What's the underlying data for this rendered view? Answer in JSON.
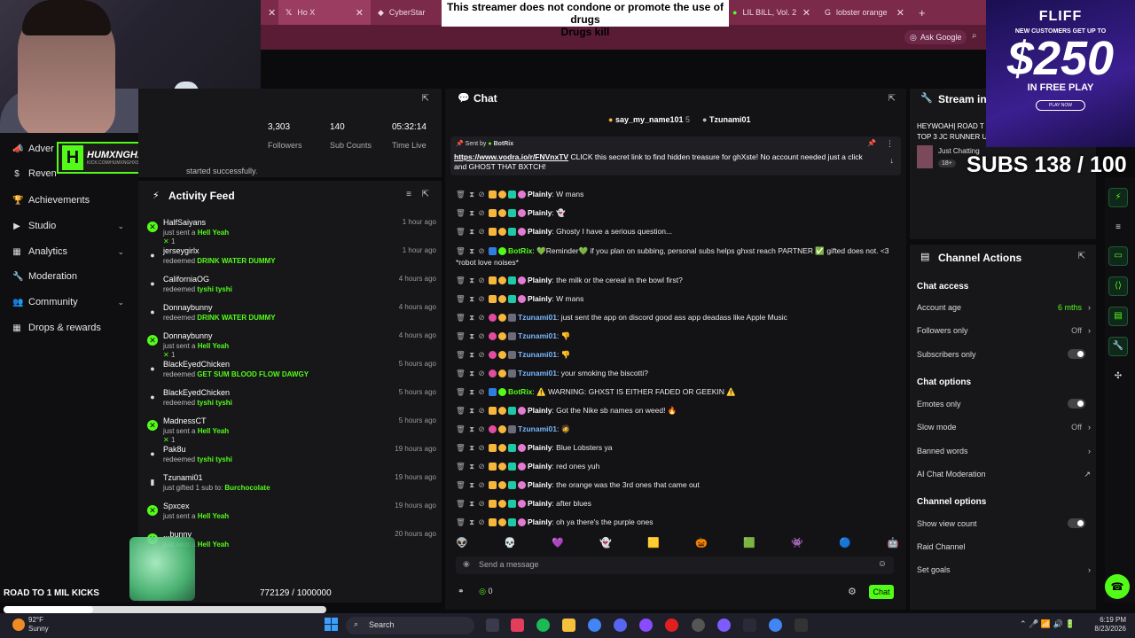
{
  "browser": {
    "tabs": [
      {
        "label": "Ho X",
        "active": true
      },
      {
        "label": "CyberStar",
        "active": false
      },
      {
        "label": "LIL BILL, Vol. 2",
        "active": false
      },
      {
        "label": "lobster orange",
        "active": false
      }
    ],
    "ask_google": "Ask Google",
    "banner_line1": "This streamer does not condone or promote the use of drugs",
    "banner_line2": "Drugs kill"
  },
  "overlay": {
    "logo_name": "HUMXNGHXST",
    "logo_sub": "KICK.COM/HUMXNGHXST",
    "subs": "SUBS 138 / 100",
    "road_label": "ROAD TO 1 MIL KICKS",
    "road_count": "772129 / 1000000",
    "road_progress": 0.772,
    "fliff": {
      "brand": "FLIFF",
      "new_customers": "NEW CUSTOMERS GET UP TO",
      "amount": "$250",
      "free_play": "IN FREE PLAY",
      "play_now": "PLAY NOW"
    }
  },
  "sidebar": {
    "items": [
      {
        "label": "Adver",
        "icon": "megaphone-icon",
        "chevron": false
      },
      {
        "label": "Reven",
        "icon": "dollar-icon",
        "chevron": false
      },
      {
        "label": "Achievements",
        "icon": "medal-icon",
        "chevron": false
      },
      {
        "label": "Studio",
        "icon": "studio-icon",
        "chevron": true
      },
      {
        "label": "Analytics",
        "icon": "chart-icon",
        "chevron": true
      },
      {
        "label": "Moderation",
        "icon": "wrench-icon",
        "chevron": false
      },
      {
        "label": "Community",
        "icon": "people-icon",
        "chevron": true
      },
      {
        "label": "Drops & rewards",
        "icon": "grid-icon",
        "chevron": false
      }
    ]
  },
  "stats": {
    "followers_value": "3,303",
    "followers_label": "Followers",
    "subs_value": "140",
    "subs_label": "Sub Counts",
    "time_value": "05:32:14",
    "time_label": "Time Live",
    "status": "started successfully."
  },
  "activity": {
    "title": "Activity Feed",
    "items": [
      {
        "name": "HalfSaiyans",
        "action": "just sent a",
        "item": "Hell Yeah",
        "count": "1",
        "time": "1 hour ago",
        "type": "kick"
      },
      {
        "name": "jerseygirlx",
        "action": "redeemed",
        "item": "DRINK WATER DUMMY",
        "count": "",
        "time": "1 hour ago",
        "type": "redeem"
      },
      {
        "name": "CaliforniaOG",
        "action": "redeemed",
        "item": "tyshi tyshi",
        "count": "",
        "time": "4 hours ago",
        "type": "redeem"
      },
      {
        "name": "Donnaybunny",
        "action": "redeemed",
        "item": "DRINK WATER DUMMY",
        "count": "",
        "time": "4 hours ago",
        "type": "redeem"
      },
      {
        "name": "Donnaybunny",
        "action": "just sent a",
        "item": "Hell Yeah",
        "count": "1",
        "time": "4 hours ago",
        "type": "kick"
      },
      {
        "name": "BlackEyedChicken",
        "action": "redeemed",
        "item": "GET SUM BLOOD FLOW DAWGY",
        "count": "",
        "time": "5 hours ago",
        "type": "redeem"
      },
      {
        "name": "BlackEyedChicken",
        "action": "redeemed",
        "item": "tyshi tyshi",
        "count": "",
        "time": "5 hours ago",
        "type": "redeem"
      },
      {
        "name": "MadnessCT",
        "action": "just sent a",
        "item": "Hell Yeah",
        "count": "1",
        "time": "5 hours ago",
        "type": "kick"
      },
      {
        "name": "Pak8u",
        "action": "redeemed",
        "item": "tyshi tyshi",
        "count": "",
        "time": "19 hours ago",
        "type": "redeem"
      },
      {
        "name": "Tzunami01",
        "action": "just gifted 1 sub to:",
        "item": "Burchocolate",
        "count": "",
        "time": "19 hours ago",
        "type": "gift"
      },
      {
        "name": "Spxcex",
        "action": "just sent a",
        "item": "Hell Yeah",
        "count": "",
        "time": "19 hours ago",
        "type": "kick"
      },
      {
        "name": "...bunny",
        "action": "just sent a",
        "item": "Hell Yeah",
        "count": "",
        "time": "20 hours ago",
        "type": "kick"
      }
    ]
  },
  "chat": {
    "title": "Chat",
    "top_chatters": [
      {
        "name": "say_my_name101",
        "count": "5"
      },
      {
        "name": "Tzunami01",
        "count": ""
      }
    ],
    "pinned_by_label": "Sent by",
    "pinned_by": "BotRix",
    "pinned_link": "https://www.vodra.io/r/FNVnxTV",
    "pinned_text": " CLICK this secret link to find hidden treasure for ghXste! No account needed just a click and GHOST THAT BXTCH!",
    "messages": [
      {
        "user": "Plainly",
        "text": " W mans",
        "color": "#ffffff"
      },
      {
        "user": "Plainly",
        "text": " 👻",
        "color": "#ffffff"
      },
      {
        "user": "Plainly",
        "text": " Ghosty I have a serious question...",
        "color": "#ffffff"
      },
      {
        "user": "BotRix",
        "text": " 💚Reminder💚 if you plan on subbing, personal subs helps ghxst reach PARTNER ✅ gifted does not. <3 *robot love noises*",
        "color": "#53fc18"
      },
      {
        "user": "Plainly",
        "text": " the milk or the cereal in the bowl first?",
        "color": "#ffffff"
      },
      {
        "user": "Plainly",
        "text": " W mans",
        "color": "#ffffff"
      },
      {
        "user": "Tzunami01",
        "text": " just sent the app on discord good ass app deadass like Apple Music",
        "color": "#7ab8ff"
      },
      {
        "user": "Tzunami01",
        "text": " 👎",
        "color": "#7ab8ff"
      },
      {
        "user": "Tzunami01",
        "text": " 👎",
        "color": "#7ab8ff"
      },
      {
        "user": "Tzunami01",
        "text": " your smoking the biscotti?",
        "color": "#7ab8ff"
      },
      {
        "user": "BotRix",
        "text": " ⚠️ WARNING: GHXST IS EITHER FADED OR GEEKIN ⚠️",
        "color": "#53fc18"
      },
      {
        "user": "Plainly",
        "text": " Got the Nike sb names on weed! 🔥",
        "color": "#ffffff"
      },
      {
        "user": "Tzunami01",
        "text": " 🧔",
        "color": "#7ab8ff"
      },
      {
        "user": "Plainly",
        "text": " Blue Lobsters ya",
        "color": "#ffffff"
      },
      {
        "user": "Plainly",
        "text": " red ones yuh",
        "color": "#ffffff"
      },
      {
        "user": "Plainly",
        "text": " the orange was the 3rd ones that came out",
        "color": "#ffffff"
      },
      {
        "user": "Plainly",
        "text": " after blues",
        "color": "#ffffff"
      },
      {
        "user": "Plainly",
        "text": " oh ya there's the purple ones",
        "color": "#ffffff"
      }
    ],
    "placeholder": "Send a message",
    "counter": "0",
    "send_label": "Chat"
  },
  "stream_info": {
    "title": "Stream inf",
    "stream_title": "HEYWOAH| ROAD T",
    "stream_title2": "TOP 3 JC RUNNER U",
    "category": "Just Chatting",
    "rating": "18+"
  },
  "channel_actions": {
    "title": "Channel Actions",
    "chat_access": "Chat access",
    "account_age": "Account age",
    "account_age_val": "6 mths",
    "followers_only": "Followers only",
    "followers_only_val": "Off",
    "subscribers_only": "Subscribers only",
    "chat_options": "Chat options",
    "emotes_only": "Emotes only",
    "slow_mode": "Slow mode",
    "slow_mode_val": "Off",
    "banned_words": "Banned words",
    "ai_moderation": "AI Chat Moderation",
    "channel_options": "Channel options",
    "show_view_count": "Show view count",
    "raid_channel": "Raid Channel",
    "set_goals": "Set goals"
  },
  "taskbar": {
    "temp": "92°F",
    "weather": "Sunny",
    "search": "Search",
    "time": "6:19 PM",
    "date": "8/23/2026"
  },
  "colors": {
    "accent": "#53fc18",
    "tabbar": "#7b2a49"
  }
}
